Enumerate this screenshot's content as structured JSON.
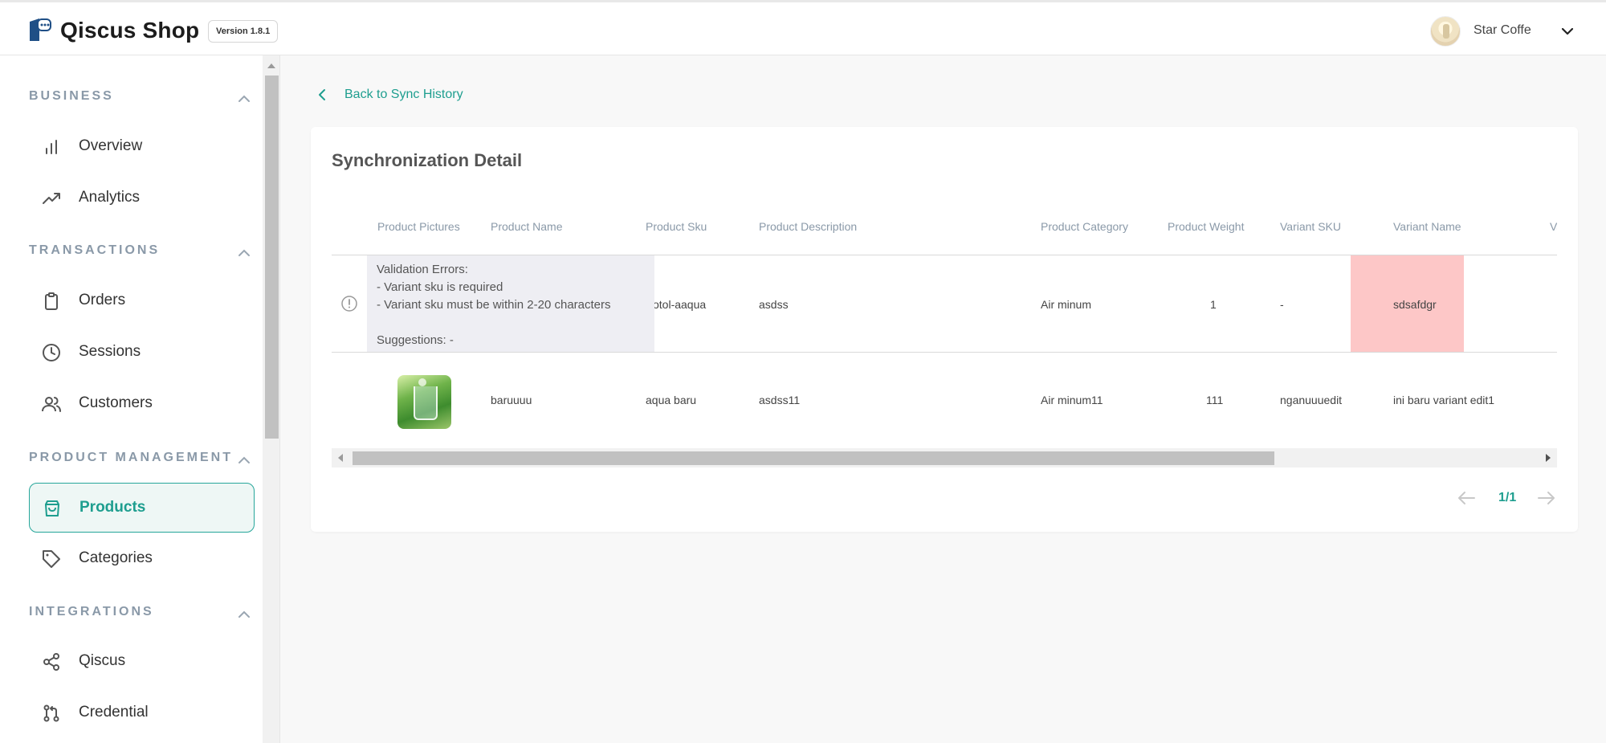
{
  "header": {
    "app_title": "Qiscus Shop",
    "version": "Version 1.8.1",
    "store_name": "Star Coffe"
  },
  "sidebar": {
    "sections": [
      {
        "title": "BUSINESS",
        "items": [
          {
            "label": "Overview",
            "icon": "bar-chart-icon"
          },
          {
            "label": "Analytics",
            "icon": "trending-up-icon"
          }
        ]
      },
      {
        "title": "TRANSACTIONS",
        "items": [
          {
            "label": "Orders",
            "icon": "clipboard-icon"
          },
          {
            "label": "Sessions",
            "icon": "clock-icon"
          },
          {
            "label": "Customers",
            "icon": "users-icon"
          }
        ]
      },
      {
        "title": "PRODUCT MANAGEMENT",
        "items": [
          {
            "label": "Products",
            "icon": "shopping-bag-icon",
            "active": true
          },
          {
            "label": "Categories",
            "icon": "tag-icon"
          }
        ]
      },
      {
        "title": "INTEGRATIONS",
        "items": [
          {
            "label": "Qiscus",
            "icon": "share-icon"
          },
          {
            "label": "Credential",
            "icon": "git-pull-request-icon"
          }
        ]
      }
    ]
  },
  "main": {
    "back_label": "Back to Sync History",
    "card_title": "Synchronization Detail",
    "table": {
      "columns": [
        "Product Pictures",
        "Product Name",
        "Product Sku",
        "Product Description",
        "Product Category",
        "Product Weight",
        "Variant SKU",
        "Variant Name",
        "Va"
      ],
      "rows": [
        {
          "product_sku": "otol-aaqua",
          "description": "asdss",
          "category": "Air minum",
          "weight": "1",
          "variant_sku": "-",
          "variant_name": "sdsafdgr"
        },
        {
          "product_name": "baruuuu",
          "product_sku": "aqua baru",
          "description": "asdss11",
          "category": "Air minum11",
          "weight": "111",
          "variant_sku": "nganuuuedit",
          "variant_name": "ini baru variant edit1"
        }
      ],
      "tooltip": {
        "title": "Validation Errors:",
        "errors": [
          "- Variant sku is required",
          "- Variant sku must be within 2-20 characters"
        ],
        "suggestions": "Suggestions: -"
      }
    },
    "pagination": "1/1"
  },
  "colors": {
    "accent": "#1e9e8f",
    "error_cell": "#fdc7c7",
    "tooltip_bg": "#eeeef3"
  }
}
